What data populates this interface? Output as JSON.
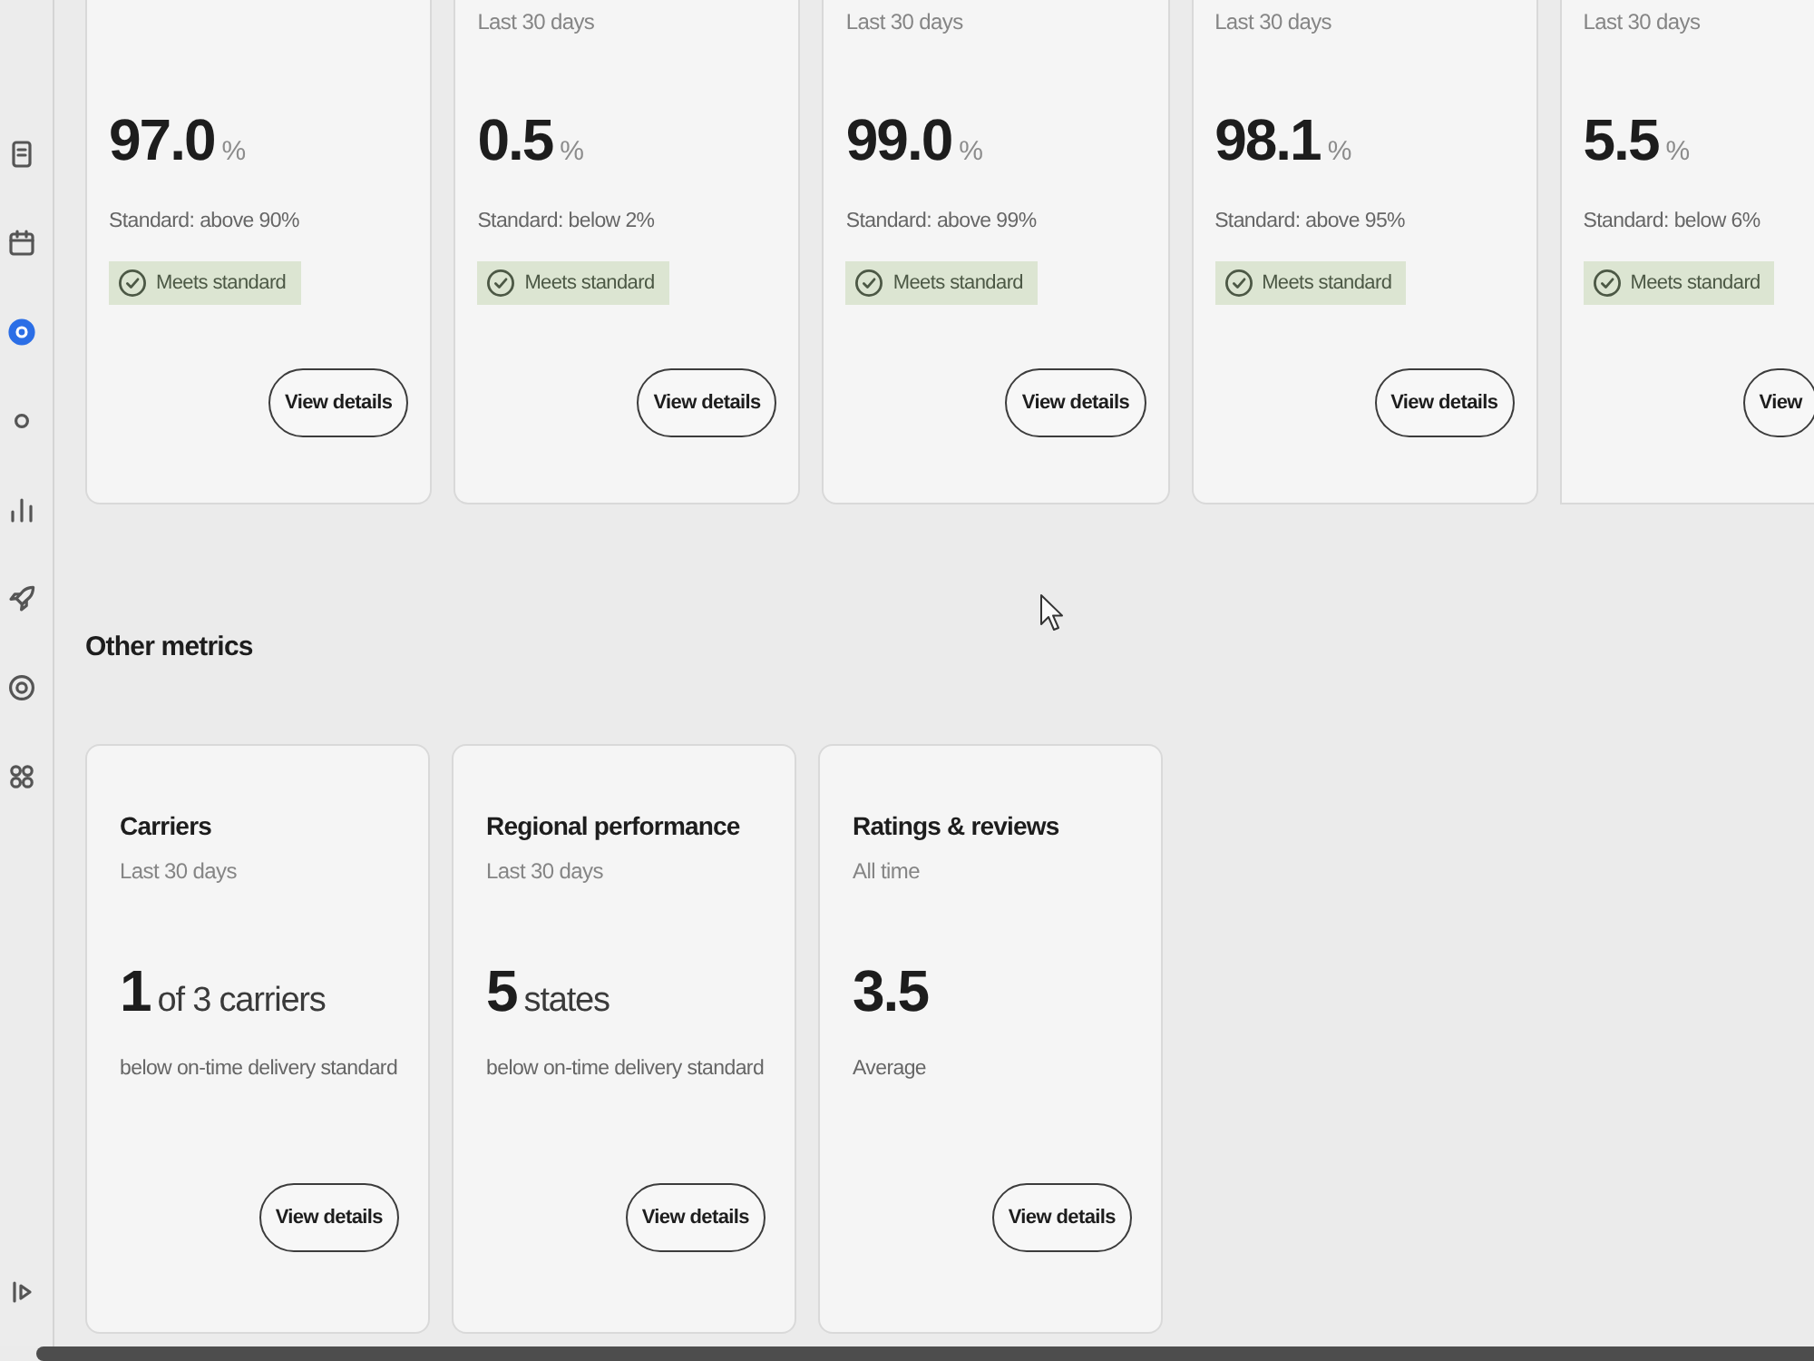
{
  "sidebar": {
    "items": [
      {
        "selected": false
      },
      {
        "selected": false
      },
      {
        "selected": true
      },
      {
        "selected": false
      },
      {
        "selected": false
      },
      {
        "selected": false
      },
      {
        "selected": false
      },
      {
        "selected": false
      }
    ]
  },
  "metric_cards": [
    {
      "value": "97.0",
      "unit": "%",
      "standard": "Standard: above 90%",
      "badge": {
        "kind": "met",
        "label": "Meets standard"
      },
      "button": "View details"
    },
    {
      "period": "Last 30 days",
      "value": "0.5",
      "unit": "%",
      "standard": "Standard: below 2%",
      "badge": {
        "kind": "met",
        "label": "Meets standard"
      },
      "button": "View details"
    },
    {
      "period": "Last 30 days",
      "value": "99.0",
      "unit": "%",
      "standard": "Standard: above 99%",
      "badge": {
        "kind": "met",
        "label": "Meets standard"
      },
      "button": "View details"
    },
    {
      "period": "Last 30 days",
      "value": "98.1",
      "unit": "%",
      "standard": "Standard: above 95%",
      "badge": {
        "kind": "met",
        "label": "Meets standard"
      },
      "button": "View details"
    },
    {
      "period": "Last 30 days",
      "value": "5.5",
      "unit": "%",
      "standard": "Standard: below 6%",
      "badge": {
        "kind": "met",
        "label": "Meets standard"
      },
      "button": "View"
    }
  ],
  "other_metrics": {
    "title": "Other metrics",
    "cards": [
      {
        "title": "Carriers",
        "period": "Last 30 days",
        "value": "1",
        "unit": "of 3 carriers",
        "description": "below on-time delivery standard",
        "button": "View details"
      },
      {
        "title": "Regional performance",
        "period": "Last 30 days",
        "value": "5",
        "unit": "states",
        "description": "below on-time delivery standard",
        "button": "View details"
      },
      {
        "title": "Ratings & reviews",
        "period": "All time",
        "value": "3.5",
        "description": "Average",
        "button": "View details"
      }
    ]
  }
}
